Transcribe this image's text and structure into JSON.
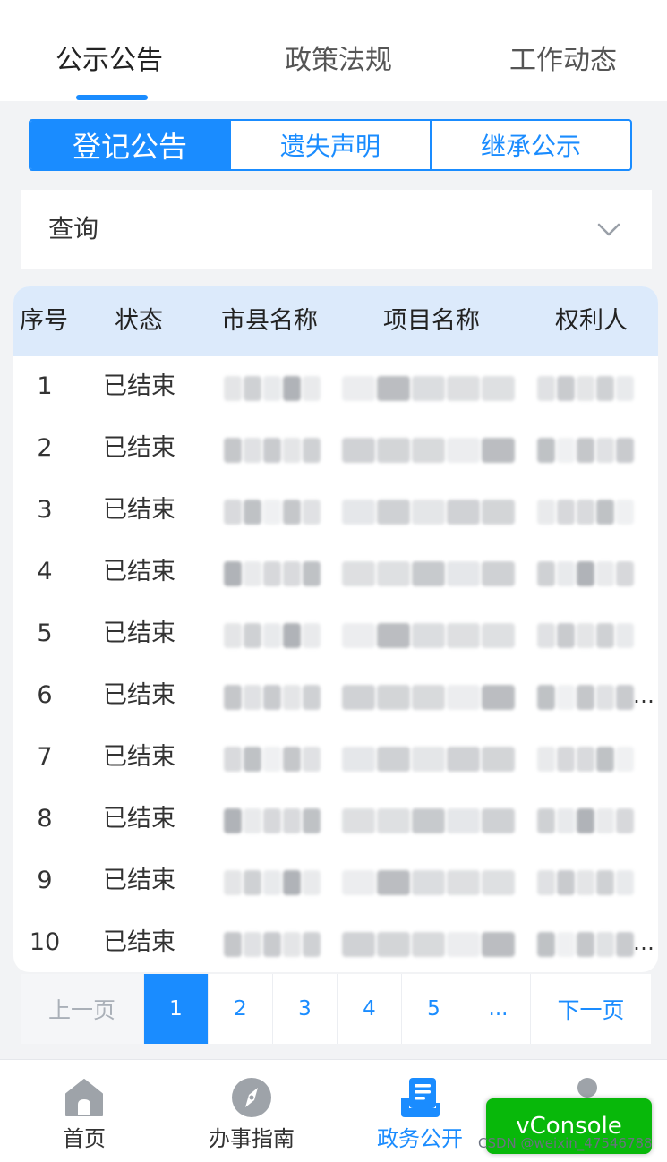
{
  "top_tabs": [
    {
      "label": "公示公告",
      "active": true
    },
    {
      "label": "政策法规",
      "active": false
    },
    {
      "label": "工作动态",
      "active": false
    }
  ],
  "segments": [
    {
      "label": "登记公告",
      "active": true
    },
    {
      "label": "遗失声明",
      "active": false
    },
    {
      "label": "继承公示",
      "active": false
    }
  ],
  "query": {
    "label": "查询",
    "icon": "chevron-down-icon"
  },
  "table": {
    "headers": [
      "序号",
      "状态",
      "市县名称",
      "项目名称",
      "权利人"
    ],
    "rows": [
      {
        "num": "1",
        "status": "已结束"
      },
      {
        "num": "2",
        "status": "已结束"
      },
      {
        "num": "3",
        "status": "已结束"
      },
      {
        "num": "4",
        "status": "已结束"
      },
      {
        "num": "5",
        "status": "已结束"
      },
      {
        "num": "6",
        "status": "已结束",
        "overflow": "…"
      },
      {
        "num": "7",
        "status": "已结束"
      },
      {
        "num": "8",
        "status": "已结束"
      },
      {
        "num": "9",
        "status": "已结束"
      },
      {
        "num": "10",
        "status": "已结束",
        "overflow": "…"
      }
    ]
  },
  "pagination": {
    "prev": "上一页",
    "pages": [
      "1",
      "2",
      "3",
      "4",
      "5",
      "..."
    ],
    "current": "1",
    "next": "下一页"
  },
  "bottom_nav": [
    {
      "label": "首页",
      "icon": "home-icon",
      "active": false
    },
    {
      "label": "办事指南",
      "icon": "compass-icon",
      "active": false
    },
    {
      "label": "政务公开",
      "icon": "news-icon",
      "active": true
    },
    {
      "label": "",
      "icon": "user-icon",
      "active": false
    }
  ],
  "vconsole": {
    "label": "vConsole"
  },
  "watermark": "CSDN @weixin_47546788",
  "colors": {
    "accent": "#1a8cff",
    "header_bg": "#dceafb",
    "vconsole": "#08b80a"
  }
}
